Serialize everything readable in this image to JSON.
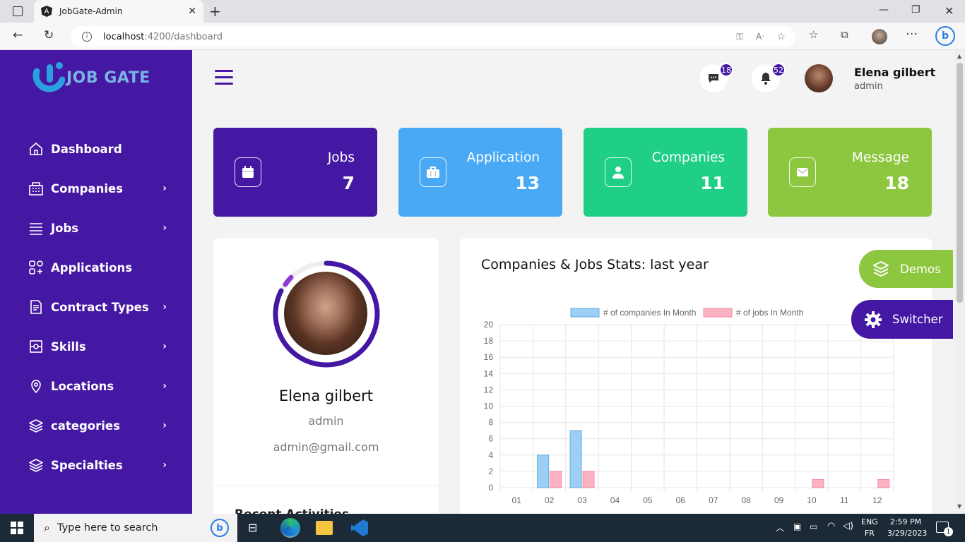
{
  "browser": {
    "tab_title": "JobGate-Admin",
    "url_host": "localhost",
    "url_path": ":4200/dashboard"
  },
  "sidebar": {
    "logo_text": "JOB GATE",
    "items": [
      {
        "label": "Dashboard",
        "icon": "home-icon",
        "has_submenu": false
      },
      {
        "label": "Companies",
        "icon": "building-icon",
        "has_submenu": true
      },
      {
        "label": "Jobs",
        "icon": "list-icon",
        "has_submenu": true
      },
      {
        "label": "Applications",
        "icon": "apps-icon",
        "has_submenu": false
      },
      {
        "label": "Contract Types",
        "icon": "document-icon",
        "has_submenu": true
      },
      {
        "label": "Skills",
        "icon": "puzzle-icon",
        "has_submenu": true
      },
      {
        "label": "Locations",
        "icon": "location-pin-icon",
        "has_submenu": true
      },
      {
        "label": "categories",
        "icon": "layers-icon",
        "has_submenu": true
      },
      {
        "label": "Specialties",
        "icon": "layers-icon",
        "has_submenu": true
      }
    ]
  },
  "header": {
    "messages_count": "18",
    "notifications_count": "52",
    "user_name": "Elena gilbert",
    "user_role": "admin"
  },
  "stats": [
    {
      "title": "Jobs",
      "value": "7",
      "color": "#4518a4",
      "icon": "calendar-icon"
    },
    {
      "title": "Application",
      "value": "13",
      "color": "#4aa9f5",
      "icon": "briefcase-icon"
    },
    {
      "title": "Companies",
      "value": "11",
      "color": "#1fcf85",
      "icon": "user-icon"
    },
    {
      "title": "Message",
      "value": "18",
      "color": "#8dc63f",
      "icon": "mail-icon"
    }
  ],
  "profile": {
    "name": "Elena gilbert",
    "role": "admin",
    "email": "admin@gmail.com",
    "section_title": "Recent Activities"
  },
  "chart_card": {
    "title": "Companies & Jobs Stats: last year"
  },
  "chart_data": {
    "type": "bar",
    "categories": [
      "01",
      "02",
      "03",
      "04",
      "05",
      "06",
      "07",
      "08",
      "09",
      "10",
      "11",
      "12"
    ],
    "series": [
      {
        "name": "# of companies In Month",
        "values": [
          0,
          4,
          7,
          0,
          0,
          0,
          0,
          0,
          0,
          0,
          0,
          0
        ],
        "color": "#9ccff3"
      },
      {
        "name": "# of jobs In Month",
        "values": [
          0,
          2,
          2,
          0,
          0,
          0,
          0,
          0,
          0,
          1,
          0,
          1
        ],
        "color": "#fbb3c3"
      }
    ],
    "ylim": [
      0,
      20
    ],
    "yticks": [
      "0",
      "2",
      "4",
      "6",
      "8",
      "10",
      "12",
      "14",
      "16",
      "18",
      "20"
    ],
    "legend": "top",
    "grid": true
  },
  "floating": {
    "demos_label": "Demos",
    "switcher_label": "Switcher"
  },
  "taskbar": {
    "search_placeholder": "Type here to search",
    "lang_top": "ENG",
    "lang_bottom": "FR",
    "time": "2:59 PM",
    "date": "3/29/2023",
    "notif_count": "1"
  }
}
